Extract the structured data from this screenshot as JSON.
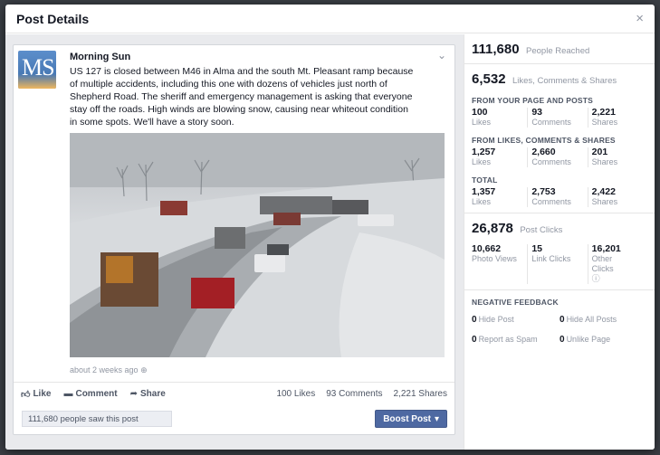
{
  "modal": {
    "title": "Post Details",
    "close": "×"
  },
  "post": {
    "page_name": "Morning Sun",
    "avatar_text": "MS",
    "text": "US 127 is closed between M46 in Alma and the south Mt. Pleasant ramp because of multiple accidents, including this one with dozens of vehicles just north of Shepherd Road. The sheriff and emergency management is asking that everyone stay off the roads. High winds are blowing snow, causing near whiteout condition in some spots. We'll have a story soon.",
    "timestamp": "about 2 weeks ago",
    "actions": {
      "like": "Like",
      "comment": "Comment",
      "share": "Share"
    },
    "counts": {
      "likes": "100 Likes",
      "comments": "93 Comments",
      "shares": "2,221 Shares"
    },
    "saw_text": "111,680 people saw this post",
    "boost_label": "Boost Post"
  },
  "insights": {
    "reach": {
      "value": "111,680",
      "label": "People Reached"
    },
    "engagement": {
      "value": "6,532",
      "label": "Likes, Comments & Shares"
    },
    "from_page": {
      "title": "FROM YOUR PAGE AND POSTS",
      "items": [
        {
          "num": "100",
          "lbl": "Likes"
        },
        {
          "num": "93",
          "lbl": "Comments"
        },
        {
          "num": "2,221",
          "lbl": "Shares"
        }
      ]
    },
    "from_shares": {
      "title": "FROM LIKES, COMMENTS & SHARES",
      "items": [
        {
          "num": "1,257",
          "lbl": "Likes"
        },
        {
          "num": "2,660",
          "lbl": "Comments"
        },
        {
          "num": "201",
          "lbl": "Shares"
        }
      ]
    },
    "total": {
      "title": "TOTAL",
      "items": [
        {
          "num": "1,357",
          "lbl": "Likes"
        },
        {
          "num": "2,753",
          "lbl": "Comments"
        },
        {
          "num": "2,422",
          "lbl": "Shares"
        }
      ]
    },
    "clicks": {
      "value": "26,878",
      "label": "Post Clicks",
      "items": [
        {
          "num": "10,662",
          "lbl": "Photo Views"
        },
        {
          "num": "15",
          "lbl": "Link Clicks"
        },
        {
          "num": "16,201",
          "lbl": "Other Clicks"
        }
      ]
    },
    "negative": {
      "title": "NEGATIVE FEEDBACK",
      "items": [
        {
          "num": "0",
          "lbl": "Hide Post"
        },
        {
          "num": "0",
          "lbl": "Hide All Posts"
        },
        {
          "num": "0",
          "lbl": "Report as Spam"
        },
        {
          "num": "0",
          "lbl": "Unlike Page"
        }
      ]
    }
  },
  "colors": {
    "brand_blue": "#4e69a2",
    "muted": "#9197a3",
    "text": "#141823"
  }
}
